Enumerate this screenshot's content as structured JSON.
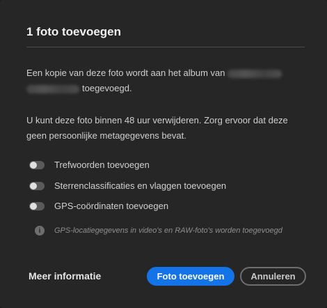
{
  "dialog": {
    "title": "1 foto toevoegen",
    "paragraph1": {
      "before": "Een kopie van deze foto wordt aan het album van",
      "after": "toegevoegd."
    },
    "paragraph2": "U kunt deze foto binnen 48 uur verwijderen. Zorg ervoor dat deze geen persoonlijke metagegevens bevat.",
    "toggles": [
      {
        "label": "Trefwoorden toevoegen",
        "on": false
      },
      {
        "label": "Sterrenclassificaties en vlaggen toevoegen",
        "on": false
      },
      {
        "label": "GPS-coördinaten toevoegen",
        "on": false
      }
    ],
    "info_text": "GPS-locatiegegevens in video's en RAW-foto's worden toegevoegd",
    "info_icon": "i",
    "more_info_label": "Meer informatie",
    "primary_button": "Foto toevoegen",
    "secondary_button": "Annuleren"
  },
  "colors": {
    "background": "#262626",
    "accent": "#1473e6",
    "toggle_off": "#5a5a5a"
  },
  "icons": [
    "info-icon",
    "toggle-switch"
  ]
}
